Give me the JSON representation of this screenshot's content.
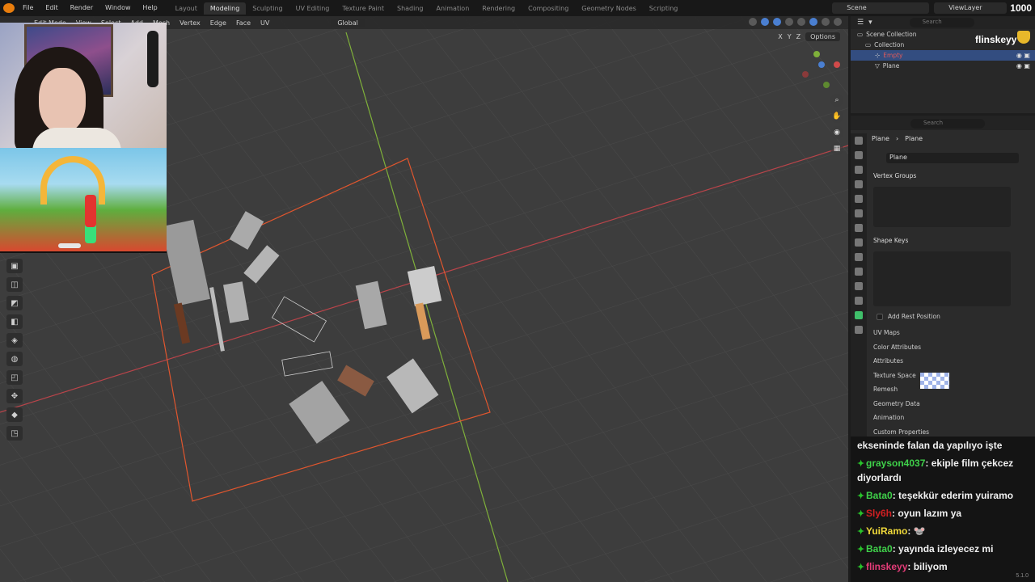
{
  "topbar": {
    "menu": [
      "File",
      "Edit",
      "Render",
      "Window",
      "Help"
    ],
    "workspaces": [
      "Layout",
      "Modeling",
      "Sculpting",
      "UV Editing",
      "Texture Paint",
      "Shading",
      "Animation",
      "Rendering",
      "Compositing",
      "Geometry Nodes",
      "Scripting"
    ],
    "active_workspace": "Modeling",
    "scene": "Scene",
    "view_layer": "ViewLayer",
    "counter": "1000"
  },
  "viewport": {
    "mode": "Edit Mode",
    "menus": [
      "View",
      "Select",
      "Add",
      "Mesh",
      "Vertex",
      "Edge",
      "Face",
      "UV"
    ],
    "transform": "Global",
    "axes": [
      "X",
      "Y",
      "Z"
    ],
    "options": "Options"
  },
  "outliner": {
    "search_placeholder": "Search",
    "items": [
      {
        "label": "Scene Collection"
      },
      {
        "label": "Collection"
      },
      {
        "label": "Empty"
      },
      {
        "label": "Plane"
      }
    ],
    "streamer_name": "flinskeyy"
  },
  "properties": {
    "search_placeholder": "Search",
    "breadcrumb": [
      "Plane",
      "Plane"
    ],
    "mesh_name": "Plane",
    "sections": {
      "vertex_groups": "Vertex Groups",
      "shape_keys": "Shape Keys",
      "add_rest_position": "Add Rest Position",
      "uv_maps": "UV Maps",
      "color_attributes": "Color Attributes",
      "attributes": "Attributes",
      "texture_space": "Texture Space",
      "remesh": "Remesh",
      "geometry_data": "Geometry Data",
      "animation": "Animation",
      "custom_properties": "Custom Properties"
    }
  },
  "chat": {
    "partial": "ekseninde falan da yapılıyo işte",
    "messages": [
      {
        "user": "grayson4037",
        "text": ": ekiple film çekcez diyorlardı",
        "color": "#3fd14a"
      },
      {
        "user": "Bata0",
        "text": ": teşekkür ederim yuiramo",
        "color": "#3fd14a"
      },
      {
        "user": "Sly6h",
        "text": ": oyun lazım ya",
        "color": "#d11f22"
      },
      {
        "user": "YuiRamo",
        "text": ": ",
        "color": "#f0d93a"
      },
      {
        "user": "Bata0",
        "text": ": yayında izleyecez mi",
        "color": "#3fd14a"
      },
      {
        "user": "flinskeyy",
        "text": ": biliyom",
        "color": "#e53c79"
      }
    ],
    "version": "5.1.0"
  },
  "icons": {
    "badge": "sword-badge-icon",
    "eye": "eye-icon"
  }
}
